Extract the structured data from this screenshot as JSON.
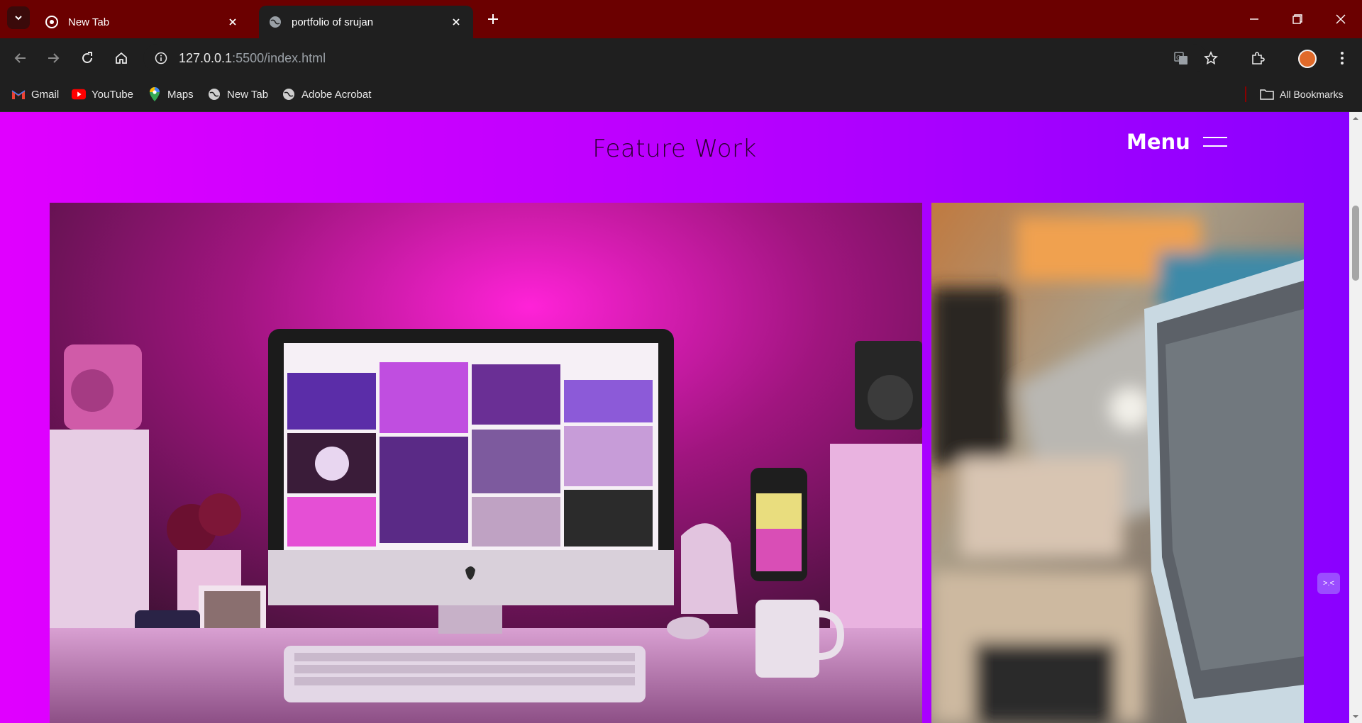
{
  "browser": {
    "tabs": [
      {
        "title": "New Tab",
        "active": false
      },
      {
        "title": "portfolio of srujan",
        "active": true
      }
    ],
    "url": {
      "host": "127.0.0.1",
      "path": ":5500/index.html"
    },
    "bookmarks": [
      {
        "label": "Gmail",
        "icon": "gmail-icon"
      },
      {
        "label": "YouTube",
        "icon": "youtube-icon"
      },
      {
        "label": "Maps",
        "icon": "maps-icon"
      },
      {
        "label": "New Tab",
        "icon": "globe-icon"
      },
      {
        "label": "Adobe Acrobat",
        "icon": "globe-icon"
      }
    ],
    "all_bookmarks_label": "All Bookmarks",
    "frame_color": "#6b0000"
  },
  "page": {
    "section_title": "Feature Work",
    "menu_label": "Menu",
    "gradient": [
      "#e000ff",
      "#8a00ff"
    ],
    "works": [
      {
        "name": "workspace-pink-desk-photo"
      },
      {
        "name": "laptop-blurred-photo"
      }
    ]
  }
}
